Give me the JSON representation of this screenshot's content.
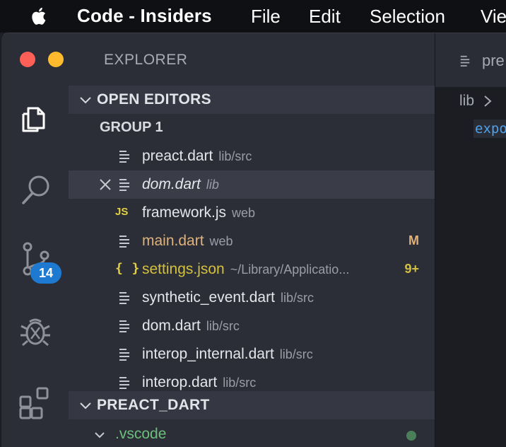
{
  "menubar": {
    "app_name": "Code - Insiders",
    "items": [
      "File",
      "Edit",
      "Selection",
      "Vie"
    ]
  },
  "sidebar": {
    "title": "EXPLORER",
    "open_editors": {
      "header": "OPEN EDITORS",
      "group_label": "GROUP 1",
      "files": [
        {
          "name": "preact.dart",
          "desc": "lib/src",
          "icon": "lines-file-icon",
          "status": "",
          "color": "#e4e6eb"
        },
        {
          "name": "dom.dart",
          "desc": "lib",
          "icon": "lines-file-icon",
          "status": "",
          "color": "#e4e6eb"
        },
        {
          "name": "framework.js",
          "desc": "web",
          "icon": "js-file-icon",
          "icon_text": "JS",
          "status": "",
          "color": "#e4e6eb"
        },
        {
          "name": "main.dart",
          "desc": "web",
          "icon": "lines-file-icon",
          "status": "M",
          "color": "#dfb27b"
        },
        {
          "name": "settings.json",
          "desc": "~/Library/Applicatio...",
          "icon": "json-file-icon",
          "icon_text": "{}",
          "status": "9+",
          "color": "#d4c03c"
        },
        {
          "name": "synthetic_event.dart",
          "desc": "lib/src",
          "icon": "lines-file-icon",
          "status": "",
          "color": "#e4e6eb"
        },
        {
          "name": "dom.dart",
          "desc": "lib/src",
          "icon": "lines-file-icon",
          "status": "",
          "color": "#e4e6eb"
        },
        {
          "name": "interop_internal.dart",
          "desc": "lib/src",
          "icon": "lines-file-icon",
          "status": "",
          "color": "#e4e6eb"
        },
        {
          "name": "interop.dart",
          "desc": "lib/src",
          "icon": "lines-file-icon",
          "status": "",
          "color": "#e4e6eb"
        }
      ]
    },
    "project": {
      "header": "PREACT_DART",
      "items": [
        {
          "name": ".vscode",
          "color": "#6bbf7a"
        }
      ]
    }
  },
  "activity": {
    "scm_badge": "14"
  },
  "editor": {
    "tab_label": "pre",
    "breadcrumb": "lib",
    "code_line": "expo"
  },
  "colors": {
    "modified": "#dfb27b",
    "warning": "#d4c03c",
    "accent": "#1e7ad1",
    "untracked_dot": "#4b7f5a"
  }
}
